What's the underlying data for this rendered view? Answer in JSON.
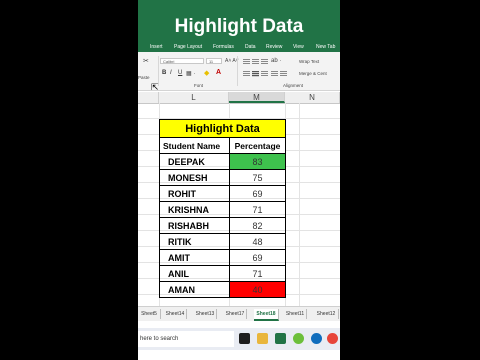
{
  "banner": {
    "title": "Highlight Data",
    "tabs": [
      "Insert",
      "Page Layout",
      "Formulas",
      "Data",
      "Review",
      "View",
      "New Tab"
    ]
  },
  "ribbon": {
    "paste_label": "Paste",
    "font_name": "Calibri",
    "font_size": "11",
    "bold": "B",
    "italic": "I",
    "underline": "U",
    "font_group": "Font",
    "alignment_group": "Alignment",
    "wrap_text": "Wrap Text",
    "merge_center": "Merge & Cent"
  },
  "columns": [
    "L",
    "M",
    "N"
  ],
  "table": {
    "title": "Highlight Data",
    "headers": [
      "Student Name",
      "Percentage"
    ],
    "rows": [
      {
        "name": "DEEPAK",
        "pct": "83",
        "highlight": "high"
      },
      {
        "name": "MONESH",
        "pct": "75",
        "highlight": ""
      },
      {
        "name": "ROHIT",
        "pct": "69",
        "highlight": ""
      },
      {
        "name": "KRISHNA",
        "pct": "71",
        "highlight": ""
      },
      {
        "name": "RISHABH",
        "pct": "82",
        "highlight": ""
      },
      {
        "name": "RITIK",
        "pct": "48",
        "highlight": ""
      },
      {
        "name": "AMIT",
        "pct": "69",
        "highlight": ""
      },
      {
        "name": "ANIL",
        "pct": "71",
        "highlight": ""
      },
      {
        "name": "AMAN",
        "pct": "40",
        "highlight": "low"
      }
    ]
  },
  "sheets": [
    "Sheet5",
    "Sheet14",
    "Sheet13",
    "Sheet17",
    "Sheet18",
    "Sheet11",
    "Sheet12"
  ],
  "active_sheet": "Sheet18",
  "taskbar": {
    "search_placeholder": "here to search"
  },
  "colors": {
    "excel_green": "#217346",
    "high": "#3ec14d",
    "low": "#ff0000",
    "title_fill": "#ffff00"
  }
}
